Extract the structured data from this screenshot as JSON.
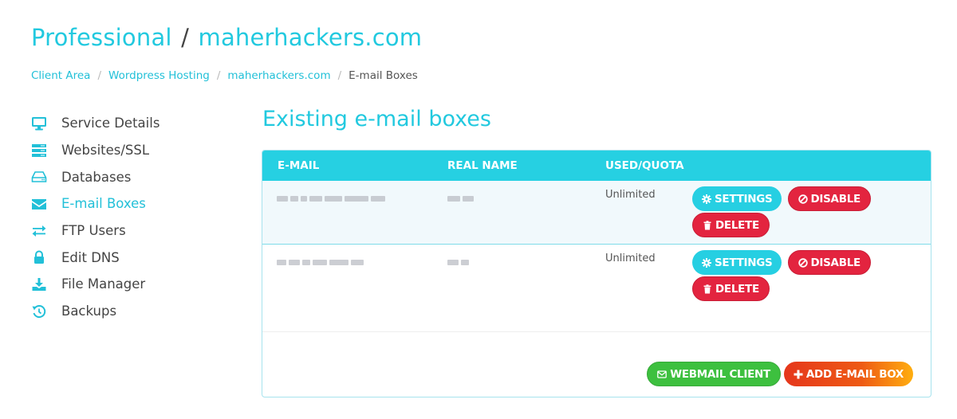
{
  "header": {
    "plan": "Professional",
    "separator": "/",
    "domain": "maherhackers.com"
  },
  "breadcrumb": [
    {
      "label": "Client Area"
    },
    {
      "label": "Wordpress Hosting"
    },
    {
      "label": "maherhackers.com"
    },
    {
      "label": "E-mail Boxes"
    }
  ],
  "breadcrumb_separator": "/",
  "sidebar": {
    "items": [
      {
        "label": "Service Details",
        "icon": "monitor-icon",
        "active": false
      },
      {
        "label": "Websites/SSL",
        "icon": "server-icon",
        "active": false
      },
      {
        "label": "Databases",
        "icon": "hdd-icon",
        "active": false
      },
      {
        "label": "E-mail Boxes",
        "icon": "envelope-icon",
        "active": true
      },
      {
        "label": "FTP Users",
        "icon": "exchange-icon",
        "active": false
      },
      {
        "label": "Edit DNS",
        "icon": "lock-icon",
        "active": false
      },
      {
        "label": "File Manager",
        "icon": "download-icon",
        "active": false
      },
      {
        "label": "Backups",
        "icon": "history-icon",
        "active": false
      }
    ]
  },
  "main": {
    "title": "Existing e-mail boxes",
    "table": {
      "columns": [
        "E-MAIL",
        "REAL NAME",
        "USED/QUOTA"
      ],
      "rows": [
        {
          "email": "[obscured]",
          "real_name": "[obscured]",
          "quota": "Unlimited"
        },
        {
          "email": "[obscured]",
          "real_name": "[obscured]",
          "quota": "Unlimited"
        }
      ],
      "row_actions": {
        "settings": "SETTINGS",
        "disable": "DISABLE",
        "delete": "DELETE"
      }
    },
    "footer": {
      "webmail": "WEBMAIL CLIENT",
      "add": "ADD E-MAIL BOX"
    }
  },
  "colors": {
    "accent": "#22c9df",
    "danger": "#e3243f",
    "success": "#3dc03f",
    "add_gradient_start": "#e5371c",
    "add_gradient_end": "#ffae0f"
  }
}
